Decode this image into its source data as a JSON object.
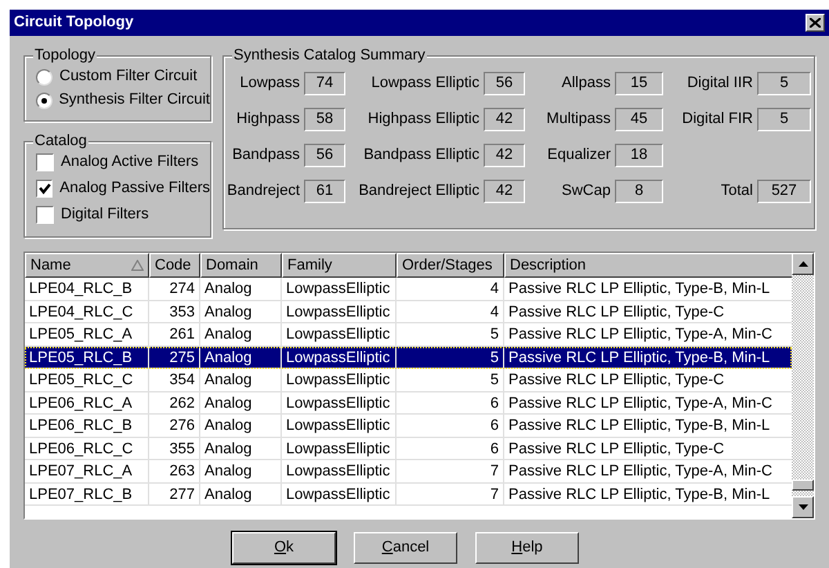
{
  "window": {
    "title": "Circuit Topology"
  },
  "topology": {
    "title": "Topology",
    "options": [
      {
        "label": "Custom Filter Circuit",
        "selected": false
      },
      {
        "label": "Synthesis Filter Circuit",
        "selected": true
      }
    ]
  },
  "catalog": {
    "title": "Catalog",
    "options": [
      {
        "label": "Analog Active Filters",
        "checked": false
      },
      {
        "label": "Analog Passive Filters",
        "checked": true
      },
      {
        "label": "Digital Filters",
        "checked": false
      }
    ]
  },
  "summary": {
    "title": "Synthesis Catalog Summary",
    "rows": [
      [
        {
          "label": "Lowpass",
          "value": "74"
        },
        {
          "label": "Lowpass Elliptic",
          "value": "56"
        },
        {
          "label": "Allpass",
          "value": "15"
        },
        {
          "label": "Digital IIR",
          "value": "5"
        }
      ],
      [
        {
          "label": "Highpass",
          "value": "58"
        },
        {
          "label": "Highpass Elliptic",
          "value": "42"
        },
        {
          "label": "Multipass",
          "value": "45"
        },
        {
          "label": "Digital FIR",
          "value": "5"
        }
      ],
      [
        {
          "label": "Bandpass",
          "value": "56"
        },
        {
          "label": "Bandpass Elliptic",
          "value": "42"
        },
        {
          "label": "Equalizer",
          "value": "18"
        },
        null
      ],
      [
        {
          "label": "Bandreject",
          "value": "61"
        },
        {
          "label": "Bandreject Elliptic",
          "value": "42"
        },
        {
          "label": "SwCap",
          "value": "8"
        },
        {
          "label": "Total",
          "value": "527"
        }
      ]
    ]
  },
  "table": {
    "columns": [
      {
        "label": "Name",
        "sorted": true
      },
      {
        "label": "Code",
        "sorted": false
      },
      {
        "label": "Domain",
        "sorted": false
      },
      {
        "label": "Family",
        "sorted": false
      },
      {
        "label": "Order/Stages",
        "sorted": false
      },
      {
        "label": "Description",
        "sorted": false
      }
    ],
    "rows": [
      {
        "cells": [
          "LPE04_RLC_B",
          "274",
          "Analog",
          "LowpassElliptic",
          "4",
          "Passive RLC LP Elliptic, Type-B, Min-L"
        ],
        "selected": false
      },
      {
        "cells": [
          "LPE04_RLC_C",
          "353",
          "Analog",
          "LowpassElliptic",
          "4",
          "Passive RLC LP Elliptic, Type-C"
        ],
        "selected": false
      },
      {
        "cells": [
          "LPE05_RLC_A",
          "261",
          "Analog",
          "LowpassElliptic",
          "5",
          "Passive RLC LP Elliptic, Type-A, Min-C"
        ],
        "selected": false
      },
      {
        "cells": [
          "LPE05_RLC_B",
          "275",
          "Analog",
          "LowpassElliptic",
          "5",
          "Passive RLC LP Elliptic, Type-B, Min-L"
        ],
        "selected": true
      },
      {
        "cells": [
          "LPE05_RLC_C",
          "354",
          "Analog",
          "LowpassElliptic",
          "5",
          "Passive RLC LP Elliptic, Type-C"
        ],
        "selected": false
      },
      {
        "cells": [
          "LPE06_RLC_A",
          "262",
          "Analog",
          "LowpassElliptic",
          "6",
          "Passive RLC LP Elliptic, Type-A, Min-C"
        ],
        "selected": false
      },
      {
        "cells": [
          "LPE06_RLC_B",
          "276",
          "Analog",
          "LowpassElliptic",
          "6",
          "Passive RLC LP Elliptic, Type-B, Min-L"
        ],
        "selected": false
      },
      {
        "cells": [
          "LPE06_RLC_C",
          "355",
          "Analog",
          "LowpassElliptic",
          "6",
          "Passive RLC LP Elliptic, Type-C"
        ],
        "selected": false
      },
      {
        "cells": [
          "LPE07_RLC_A",
          "263",
          "Analog",
          "LowpassElliptic",
          "7",
          "Passive RLC LP Elliptic, Type-A, Min-C"
        ],
        "selected": false
      },
      {
        "cells": [
          "LPE07_RLC_B",
          "277",
          "Analog",
          "LowpassElliptic",
          "7",
          "Passive RLC LP Elliptic, Type-B, Min-L"
        ],
        "selected": false
      }
    ]
  },
  "buttons": [
    {
      "label": "Ok",
      "default": true
    },
    {
      "label": "Cancel",
      "default": false
    },
    {
      "label": "Help",
      "default": false
    }
  ]
}
